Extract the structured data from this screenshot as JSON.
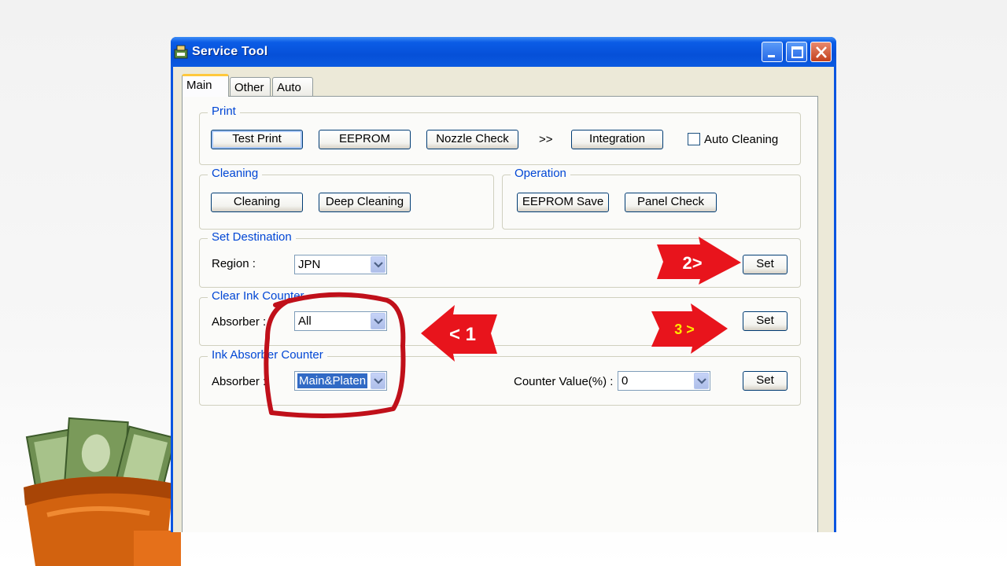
{
  "window": {
    "title": "Service Tool"
  },
  "tabs": [
    {
      "label": "Main",
      "active": true
    },
    {
      "label": "Other",
      "active": false
    },
    {
      "label": "Auto",
      "active": false
    }
  ],
  "print_group": {
    "label": "Print",
    "test_print": "Test Print",
    "eeprom": "EEPROM",
    "nozzle_check": "Nozzle Check",
    "arrows": ">>",
    "integration": "Integration",
    "auto_cleaning": "Auto Cleaning"
  },
  "cleaning_group": {
    "label": "Cleaning",
    "cleaning": "Cleaning",
    "deep_cleaning": "Deep Cleaning"
  },
  "operation_group": {
    "label": "Operation",
    "eeprom_save": "EEPROM Save",
    "panel_check": "Panel Check"
  },
  "destination_group": {
    "label": "Set Destination",
    "region_label": "Region :",
    "region_value": "JPN",
    "set": "Set"
  },
  "clear_ink_group": {
    "label": "Clear Ink Counter",
    "absorber_label": "Absorber :",
    "absorber_value": "All",
    "set": "Set"
  },
  "ink_absorber_group": {
    "label": "Ink Absorber Counter",
    "absorber_label": "Absorber :",
    "absorber_value": "Main&Platen",
    "counter_value_label": "Counter Value(%) :",
    "counter_value": "0",
    "set": "Set"
  },
  "annotations": {
    "step1": "< 1",
    "step2": "2>",
    "step3": "3 >",
    "arrow_color": "#e8141c",
    "circle_color": "#c0101a",
    "step3_text_color": "#ffe800"
  },
  "colors": {
    "titlebar": "#0a5ae0",
    "group_label": "#0046d5",
    "window_bg": "#ece9d8"
  }
}
